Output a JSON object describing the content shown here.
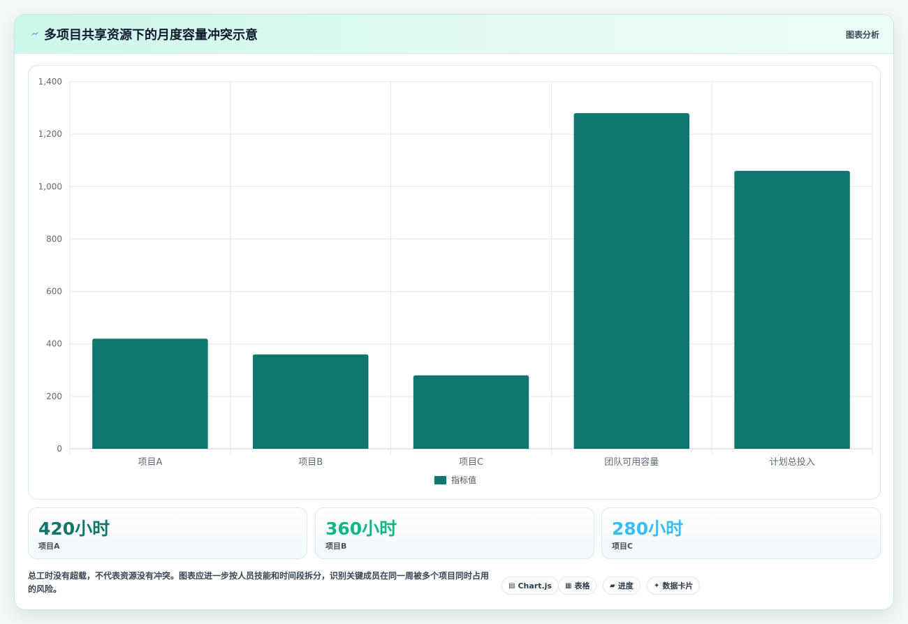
{
  "header": {
    "title": "多项目共享资源下的月度容量冲突示意",
    "link_label": "图表分析",
    "icon": "lightning-icon"
  },
  "chart_data": {
    "type": "bar",
    "categories": [
      "项目A",
      "项目B",
      "项目C",
      "团队可用容量",
      "计划总投入"
    ],
    "series": [
      {
        "name": "指标值",
        "values": [
          420,
          360,
          280,
          1280,
          1060
        ],
        "color": "#10776f"
      }
    ],
    "ylim": [
      0,
      1400
    ],
    "yticks": [
      0,
      200,
      400,
      600,
      800,
      1000,
      1200,
      1400
    ],
    "ytick_labels": [
      "0",
      "200",
      "400",
      "600",
      "800",
      "1,000",
      "1,200",
      "1,400"
    ],
    "grid": true,
    "legend_position": "bottom"
  },
  "stats": [
    {
      "value": "420小时",
      "label": "项目A",
      "color": "#0f766e"
    },
    {
      "value": "360小时",
      "label": "项目B",
      "color": "#10b981"
    },
    {
      "value": "280小时",
      "label": "项目C",
      "color": "#38bdf8"
    }
  ],
  "note": "总工时没有超载，不代表资源没有冲突。图表应进一步按人员技能和时间段拆分，识别关键成员在同一周被多个项目同时占用的风险。",
  "chips": [
    {
      "icon": "▤",
      "label": "Chart.js",
      "icon_name": "chart-icon"
    },
    {
      "icon": "▦",
      "label": "表格",
      "icon_name": "table-icon"
    },
    {
      "icon": "▰",
      "label": "进度",
      "icon_name": "progress-icon"
    },
    {
      "icon": "✦",
      "label": "数据卡片",
      "icon_name": "sparkle-icon"
    }
  ]
}
